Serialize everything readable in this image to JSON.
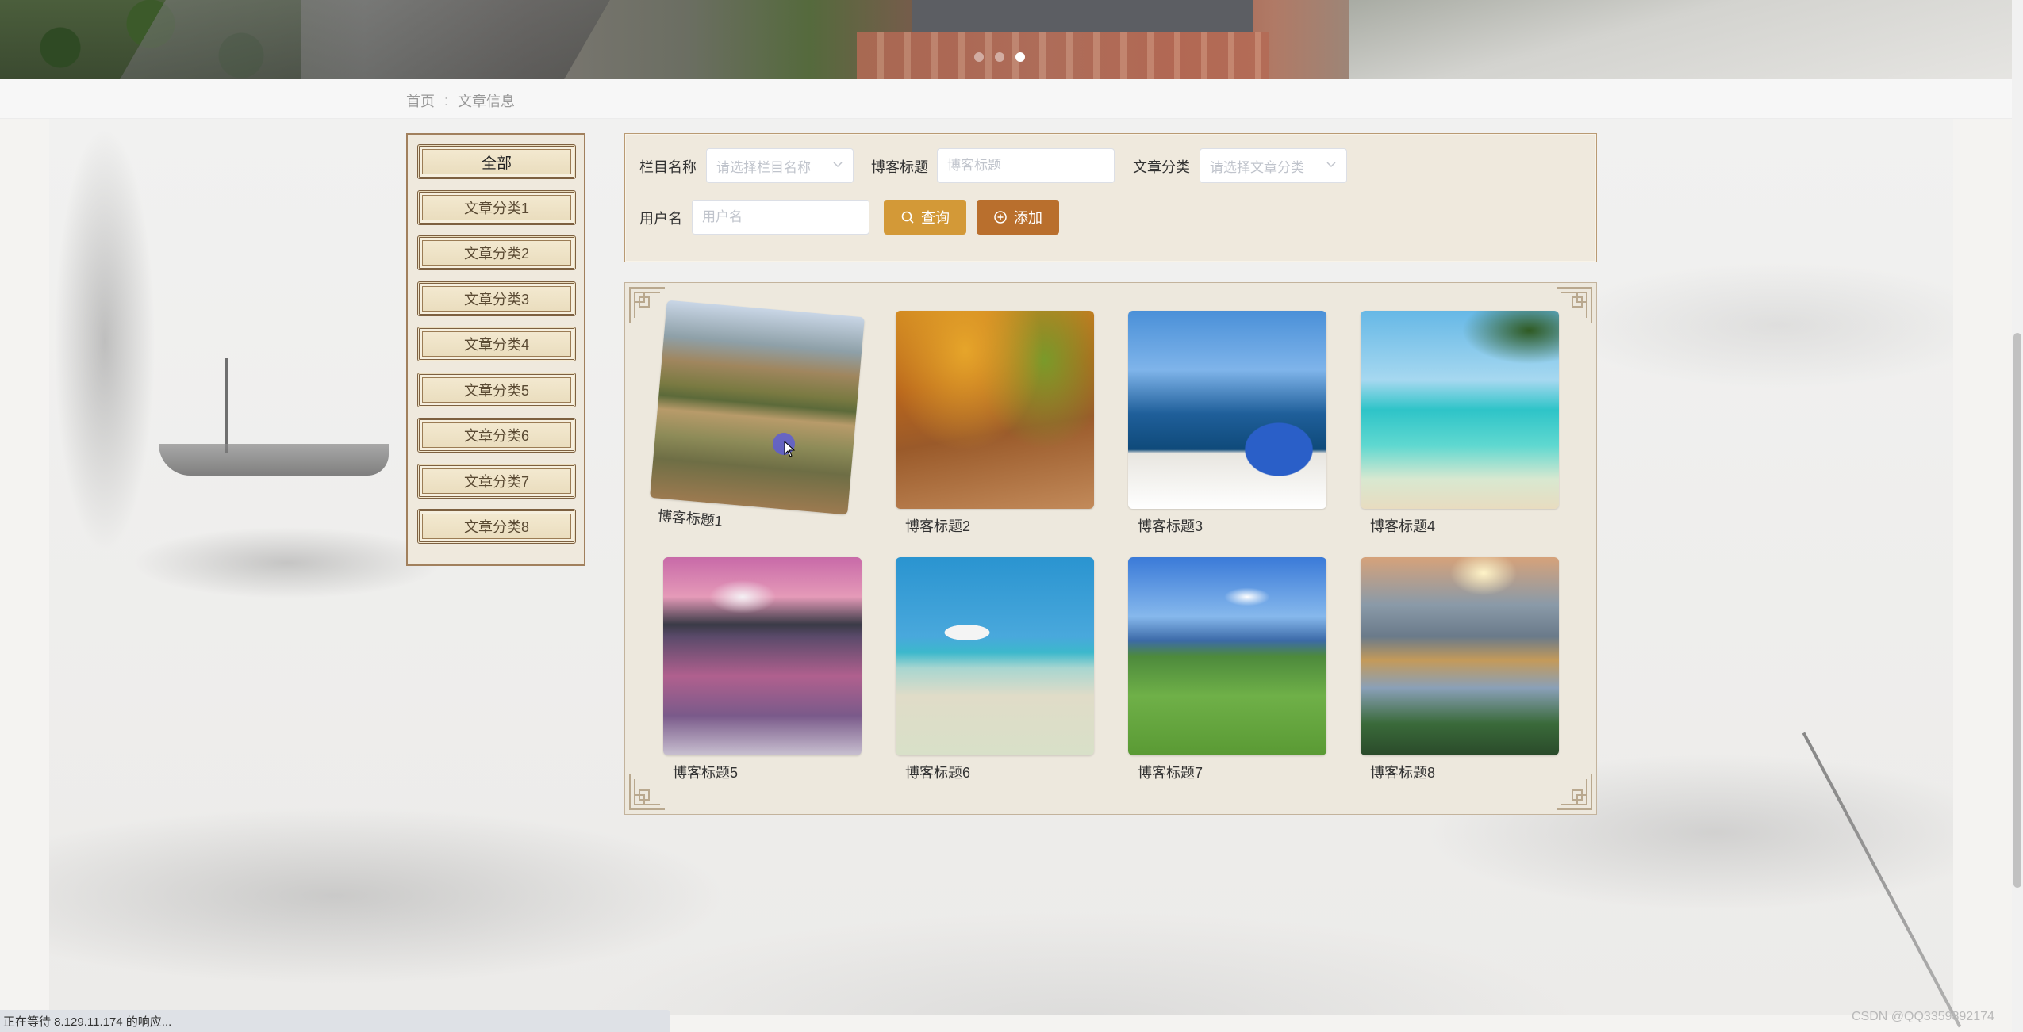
{
  "carousel": {
    "dots": 3,
    "active_index": 2
  },
  "breadcrumb": {
    "home": "首页",
    "separator": ":",
    "current": "文章信息"
  },
  "categories": [
    {
      "label": "全部",
      "active": true
    },
    {
      "label": "文章分类1"
    },
    {
      "label": "文章分类2"
    },
    {
      "label": "文章分类3"
    },
    {
      "label": "文章分类4"
    },
    {
      "label": "文章分类5"
    },
    {
      "label": "文章分类6"
    },
    {
      "label": "文章分类7"
    },
    {
      "label": "文章分类8"
    }
  ],
  "search": {
    "column_label": "栏目名称",
    "column_placeholder": "请选择栏目名称",
    "title_label": "博客标题",
    "title_placeholder": "博客标题",
    "type_label": "文章分类",
    "type_placeholder": "请选择文章分类",
    "user_label": "用户名",
    "user_placeholder": "用户名",
    "query_label": "查询",
    "add_label": "添加"
  },
  "articles": [
    {
      "title": "博客标题1",
      "image": "lake-reflection"
    },
    {
      "title": "博客标题2",
      "image": "autumn-path"
    },
    {
      "title": "博客标题3",
      "image": "santorini"
    },
    {
      "title": "博客标题4",
      "image": "tropical-beach"
    },
    {
      "title": "博客标题5",
      "image": "mountain-lake-pink"
    },
    {
      "title": "博客标题6",
      "image": "beach-umbrella"
    },
    {
      "title": "博客标题7",
      "image": "green-valley"
    },
    {
      "title": "博客标题8",
      "image": "sunset-mountains"
    }
  ],
  "status": {
    "text": "正在等待 8.129.11.174 的响应..."
  },
  "watermark": "CSDN @QQ3359892174",
  "colors": {
    "query_button": "#d39937",
    "add_button": "#b96f2d",
    "panel_border": "#a1805d"
  }
}
